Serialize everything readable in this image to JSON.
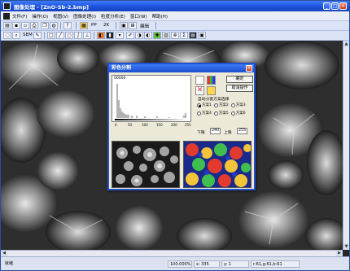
{
  "window": {
    "title": "图像处理 - [ZnO-Sb-2.bmp]",
    "controls": [
      "_",
      "□",
      "×"
    ]
  },
  "menu": {
    "items": [
      "文件(F)",
      "操作(O)",
      "视图(V)",
      "图像处理(I)",
      "粒度分析(E)",
      "窗口(W)",
      "帮助(H)"
    ]
  },
  "toolbar1": {
    "label_a": "PP",
    "label_b": "2K",
    "label_c": "编辑"
  },
  "toolbar2": {
    "label_a": "SEM"
  },
  "dialog": {
    "title": "彩色分割",
    "histogram_value": "00000",
    "x_axis_ticks": [
      "0",
      "50",
      "100",
      "150",
      "200",
      "255"
    ],
    "ok_label": "确定",
    "cancel_label": "取消操作",
    "group_label": "自动分割方案选择",
    "radio_options": [
      "方案1",
      "方案2",
      "方案3",
      "方案4",
      "方案5",
      "方案6"
    ],
    "selected_option": "方案1",
    "lower_label": "下限",
    "lower_value": "240",
    "upper_label": "上限",
    "upper_value": "255"
  },
  "status": {
    "ready": "就绪",
    "zoom": "100.000%",
    "x": "x: 335",
    "y": "y: 1",
    "rgb": "r:61,g:61,b:61"
  },
  "colors": {
    "titlebar": "#1a4fd8",
    "dialog_border": "#2452c9",
    "workspace_bg": "#262626"
  }
}
